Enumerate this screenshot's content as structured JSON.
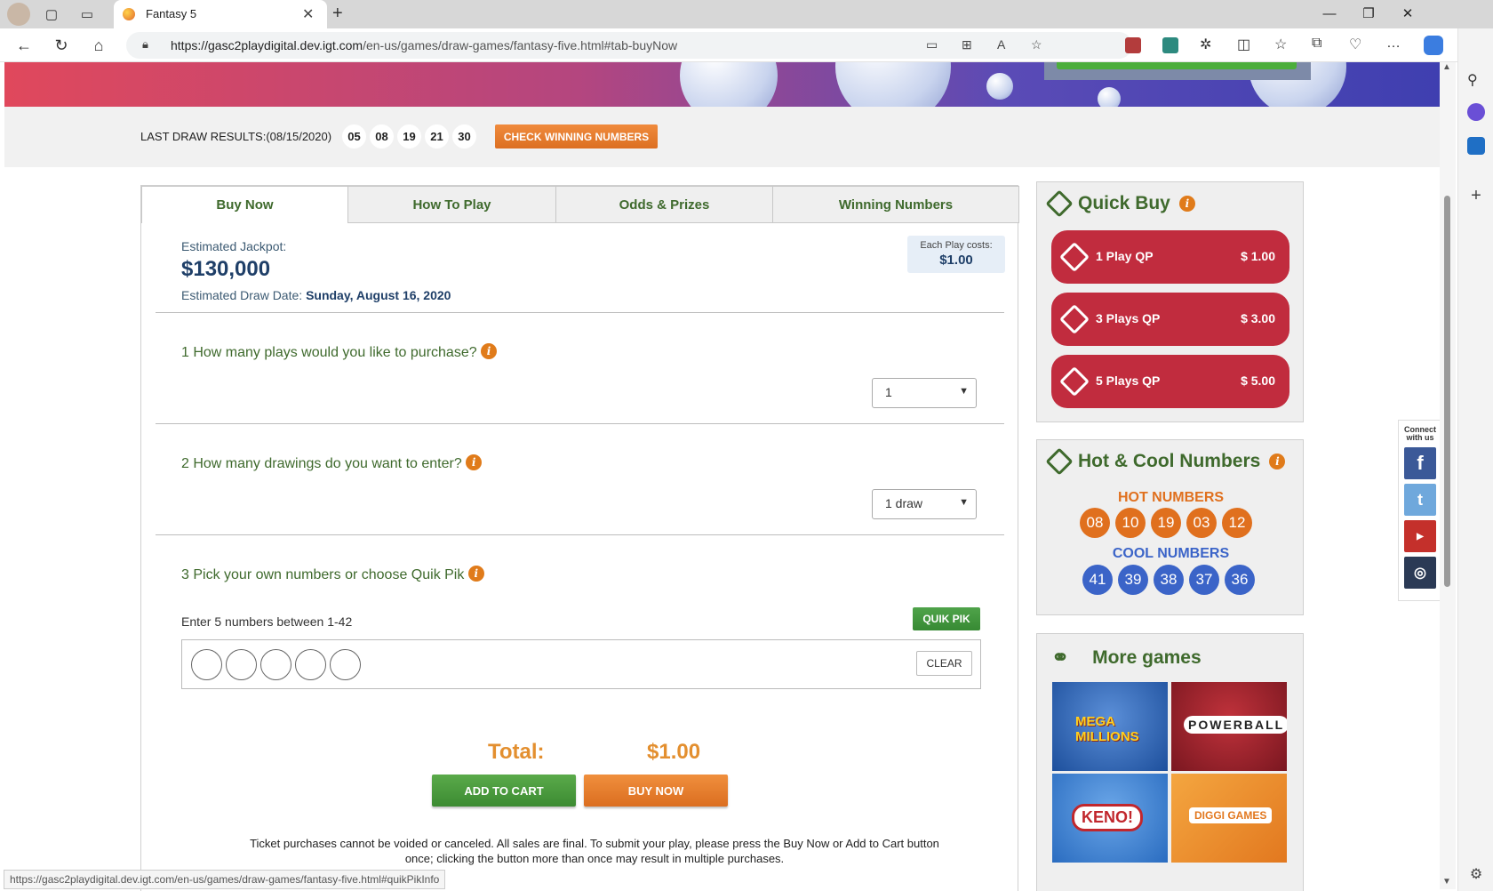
{
  "browser": {
    "tab_title": "Fantasy 5",
    "url_host": "https://gasc2playdigital.dev.igt.com",
    "url_path": "/en-us/games/draw-games/fantasy-five.html#tab-buyNow",
    "status_url": "https://gasc2playdigital.dev.igt.com/en-us/games/draw-games/fantasy-five.html#quikPikInfo"
  },
  "draw": {
    "label": "LAST DRAW RESULTS:(08/15/2020)",
    "numbers": [
      "05",
      "08",
      "19",
      "21",
      "30"
    ],
    "check_button": "CHECK WINNING NUMBERS"
  },
  "tabs": [
    "Buy Now",
    "How To Play",
    "Odds & Prizes",
    "Winning Numbers"
  ],
  "jackpot": {
    "label": "Estimated Jackpot:",
    "value": "$130,000",
    "draw_date_label": "Estimated Draw Date:",
    "draw_date_value": "Sunday, August 16, 2020",
    "cost_label": "Each Play costs:",
    "cost_value": "$1.00"
  },
  "steps": {
    "q1": "1 How many plays would you like to purchase?",
    "q1_value": "1",
    "q2": "2 How many drawings do you want to enter?",
    "q2_value": "1 draw",
    "q3": "3 Pick your own numbers or choose Quik Pik",
    "enter_label": "Enter 5 numbers between 1-42",
    "quikpik": "QUIK PIK",
    "clear": "CLEAR"
  },
  "total": {
    "label": "Total:",
    "value": "$1.00",
    "add_to_cart": "ADD TO CART",
    "buy_now": "BUY NOW",
    "disclaimer": "Ticket purchases cannot be voided or canceled. All sales are final. To submit your play, please press the Buy Now or Add to Cart button once; clicking the button more than once may result in multiple purchases."
  },
  "quick_buy": {
    "title": "Quick Buy",
    "options": [
      {
        "label": "1 Play QP",
        "price": "$ 1.00"
      },
      {
        "label": "3 Plays QP",
        "price": "$ 3.00"
      },
      {
        "label": "5 Plays QP",
        "price": "$ 5.00"
      }
    ]
  },
  "hot_cool": {
    "title": "Hot & Cool Numbers",
    "hot_label": "HOT NUMBERS",
    "hot": [
      "08",
      "10",
      "19",
      "03",
      "12"
    ],
    "cool_label": "COOL NUMBERS",
    "cool": [
      "41",
      "39",
      "38",
      "37",
      "36"
    ]
  },
  "more_games": {
    "title": "More games",
    "games": [
      "MEGA MILLIONS",
      "POWERBALL",
      "KENO!",
      "DIGGI GAMES"
    ]
  },
  "connect": {
    "label": "Connect with us"
  },
  "colors": {
    "green": "#3f6a2d",
    "orange": "#e07b1a",
    "red": "#c12c3e",
    "navy": "#1f3f68",
    "hot": "#e0701e",
    "cool": "#3b64c8"
  }
}
